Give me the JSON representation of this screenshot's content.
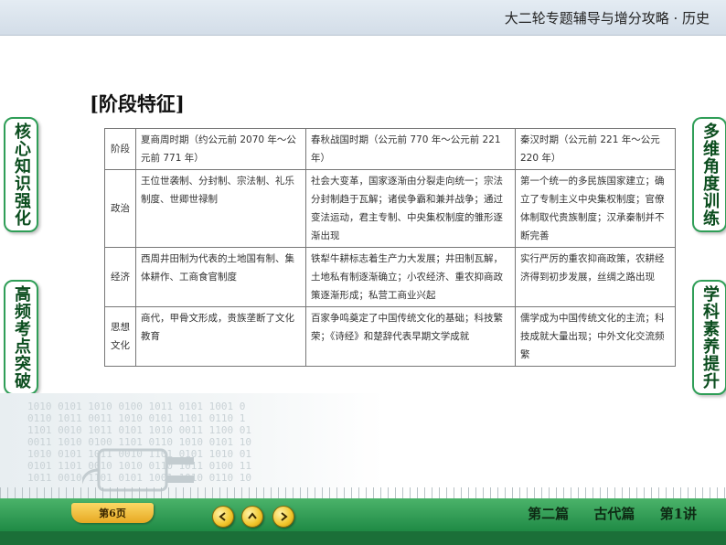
{
  "header": {
    "title": "大二轮专题辅导与增分攻略 · 历史"
  },
  "side_tabs": {
    "left_top": "核心知识强化",
    "left_bottom": "高频考点突破",
    "right_top": "多维角度训练",
    "right_bottom": "学科素养提升"
  },
  "heading": "[阶段特征]",
  "table": {
    "header": [
      "阶段",
      "夏商周时期（约公元前 2070 年～公元前 771 年）",
      "春秋战国时期（公元前 770 年～公元前 221 年）",
      "秦汉时期（公元前 221 年～公元 220 年）"
    ],
    "rows": [
      {
        "label": "政治",
        "cells": [
          "王位世袭制、分封制、宗法制、礼乐制度、世卿世禄制",
          "社会大变革，国家逐渐由分裂走向统一；宗法分封制趋于瓦解；诸侯争霸和兼并战争；通过变法运动，君主专制、中央集权制度的雏形逐渐出现",
          "第一个统一的多民族国家建立；确立了专制主义中央集权制度；官僚体制取代贵族制度；汉承秦制并不断完善"
        ]
      },
      {
        "label": "经济",
        "cells": [
          "西周井田制为代表的土地国有制、集体耕作、工商食官制度",
          "铁犁牛耕标志着生产力大发展；井田制瓦解，土地私有制逐渐确立；小农经济、重农抑商政策逐渐形成；私营工商业兴起",
          "实行严厉的重农抑商政策，农耕经济得到初步发展，丝绸之路出现"
        ]
      },
      {
        "label": "思想文化",
        "cells": [
          "商代，甲骨文形成，贵族垄断了文化教育",
          "百家争鸣奠定了中国传统文化的基础；科技繁荣；《诗经》和楚辞代表早期文学成就",
          "儒学成为中国传统文化的主流；科技成就大量出现；中外文化交流频繁"
        ]
      }
    ]
  },
  "footer": {
    "page_label": "第6页",
    "nav": {
      "prev": "chevron-left-icon",
      "home": "chevron-up-icon",
      "next": "chevron-right-icon"
    },
    "chapter": [
      "第二篇",
      "古代篇",
      "第1讲"
    ]
  },
  "colors": {
    "accent_green": "#2f9e57",
    "bar_green": "#1f8a45",
    "badge_gold": "#f0c62b"
  }
}
